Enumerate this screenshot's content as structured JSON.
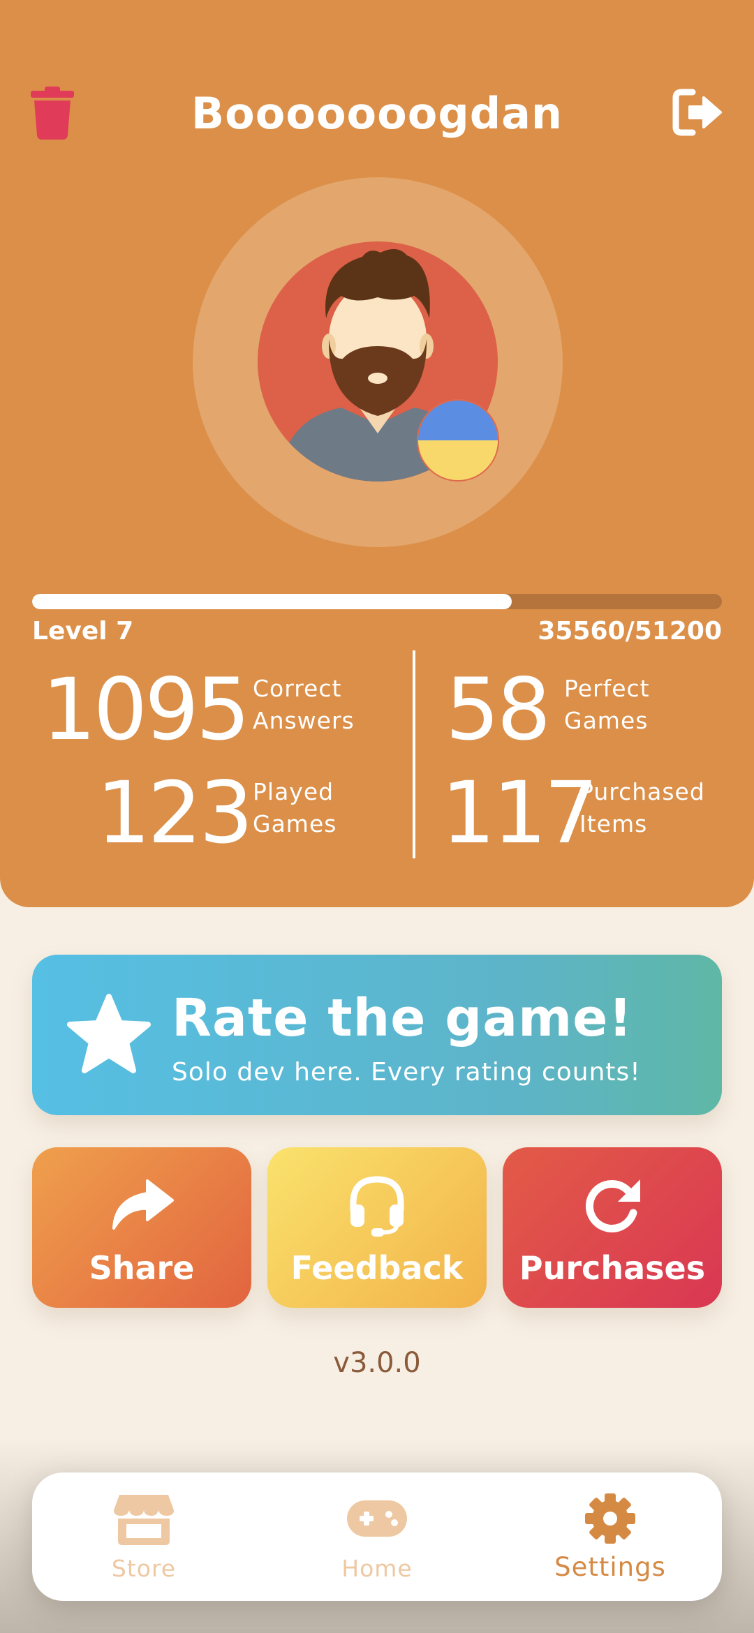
{
  "profile": {
    "username": "Booooooogdan",
    "level_label": "Level 7",
    "xp_text": "35560/51200",
    "xp_progress": 0.695,
    "trash_icon": "trash-icon",
    "logout_icon": "sign-out-icon",
    "avatar_icon": "bearded-man-avatar",
    "flag_icon": "ukraine-flag-icon",
    "colors": {
      "card": "#db8f48",
      "trash": "#e03c5a"
    }
  },
  "stats": [
    {
      "value": "1095",
      "label_line1": "Correct",
      "label_line2": "Answers"
    },
    {
      "value": "58",
      "label_line1": "Perfect",
      "label_line2": "Games"
    },
    {
      "value": "123",
      "label_line1": "Played",
      "label_line2": "Games"
    },
    {
      "value": "117",
      "label_line1": "Purchased",
      "label_line2": "Items"
    }
  ],
  "rate": {
    "title": "Rate the game!",
    "subtitle": "Solo dev here. Every rating counts!",
    "icon": "star-icon"
  },
  "actions": [
    {
      "label": "Share",
      "icon": "share-arrow-icon"
    },
    {
      "label": "Feedback",
      "icon": "headset-icon"
    },
    {
      "label": "Purchases",
      "icon": "refresh-icon"
    }
  ],
  "version": "v3.0.0",
  "tabs": [
    {
      "label": "Store",
      "icon": "store-icon",
      "active": false
    },
    {
      "label": "Home",
      "icon": "gamepad-icon",
      "active": false
    },
    {
      "label": "Settings",
      "icon": "gear-icon",
      "active": true
    }
  ]
}
